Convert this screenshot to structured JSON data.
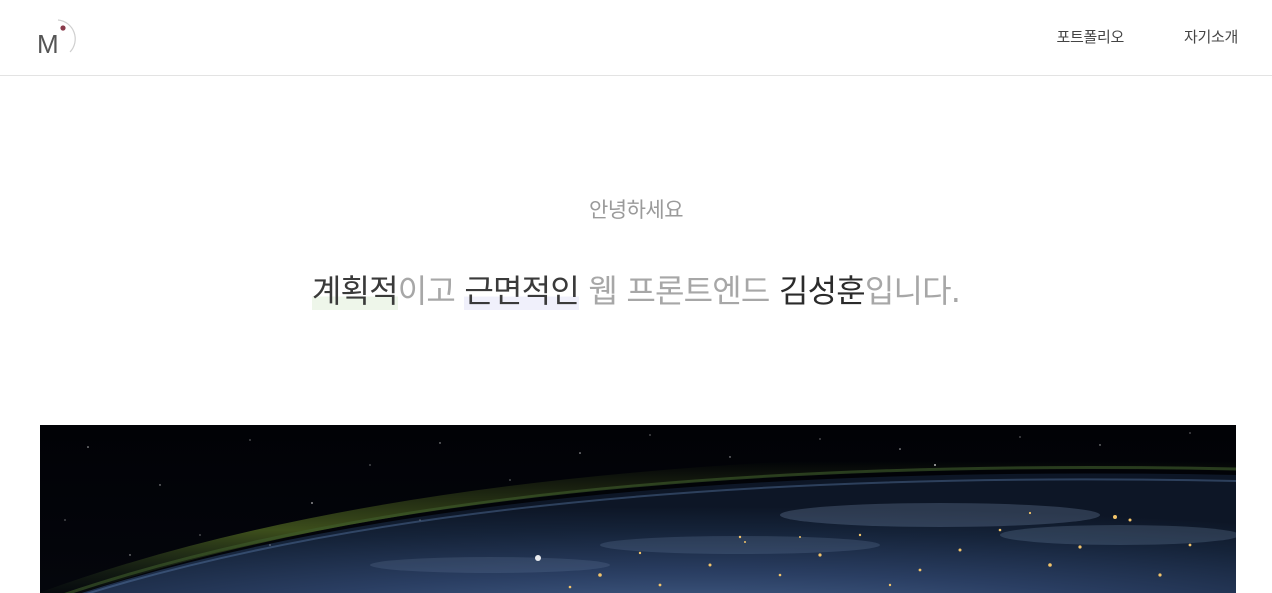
{
  "header": {
    "logo_text": "M",
    "nav": [
      {
        "label": "포트폴리오"
      },
      {
        "label": "자기소개"
      }
    ]
  },
  "hero": {
    "greeting": "안녕하세요",
    "headline": {
      "part1": "계획적",
      "part2": "이고 ",
      "part3": "근면적인",
      "part4": " 웹 프론트엔드 ",
      "part5": "김성훈",
      "part6": "입니다."
    }
  },
  "colors": {
    "accent_dark": "#2b2b2b",
    "muted_text": "#a7a7a7",
    "divider": "#e3e3e3"
  }
}
